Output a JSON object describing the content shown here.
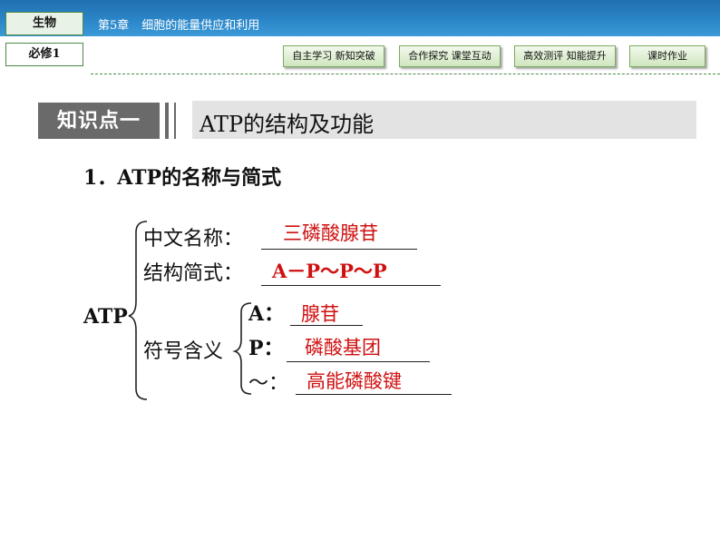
{
  "header": {
    "subject": "生物",
    "module": "必修1",
    "chapter_number": "第5章",
    "chapter_title": "细胞的能量供应和利用"
  },
  "nav": {
    "items": [
      "自主学习 新知突破",
      "合作探究 课堂互动",
      "高效测评 知能提升",
      "课时作业"
    ]
  },
  "section": {
    "badge": "知识点一",
    "title": "ATP的结构及功能"
  },
  "content": {
    "heading": "1．ATP的名称与简式",
    "root": "ATP",
    "rows": [
      {
        "label": "中文名称：",
        "answer": "三磷酸腺苷"
      },
      {
        "label": "结构简式：",
        "answer": "A－P～P～P"
      }
    ],
    "symbol_label": "符号含义",
    "symbols": [
      {
        "label": "A：",
        "answer": "腺苷"
      },
      {
        "label": "P：",
        "answer": "磷酸基团"
      },
      {
        "label": "～：",
        "answer": "高能磷酸键"
      }
    ]
  }
}
